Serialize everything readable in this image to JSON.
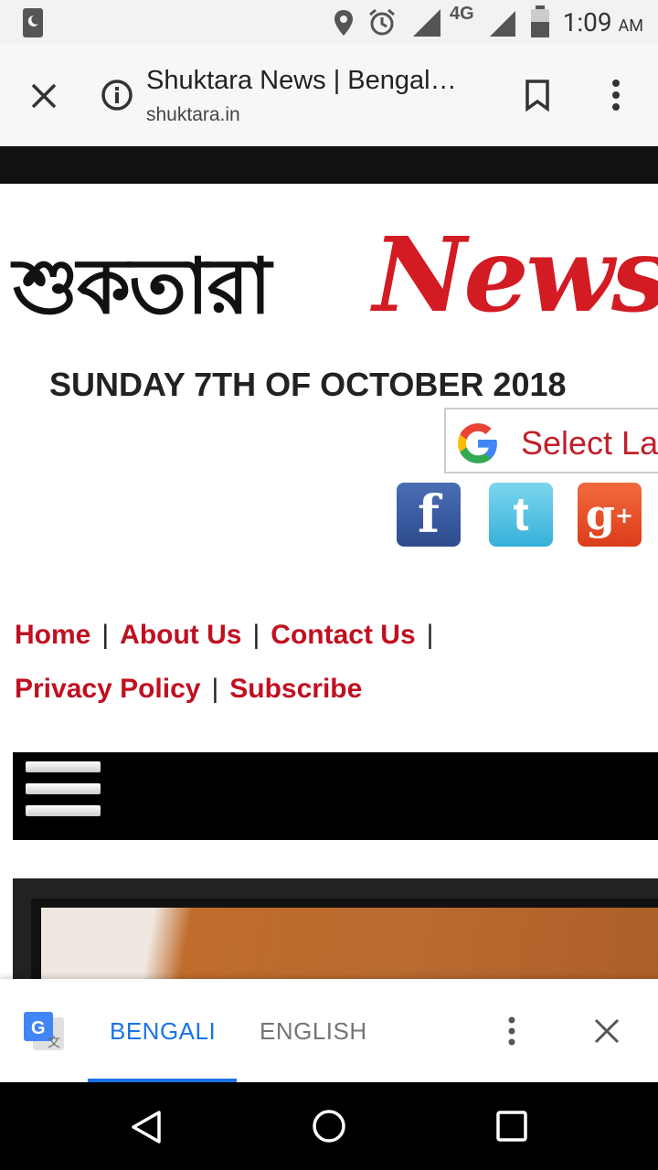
{
  "status_bar": {
    "time": "1:09",
    "ampm": "AM",
    "network": "4G"
  },
  "toolbar": {
    "title": "Shuktara News | Bengal…",
    "url": "shuktara.in"
  },
  "site": {
    "logo_bengali": "শুকতারা",
    "logo_news": "News",
    "date": "SUNDAY 7TH OF OCTOBER 2018",
    "translate_label": "Select La",
    "social": [
      "facebook",
      "twitter",
      "google-plus"
    ],
    "nav": {
      "row1": [
        "Home",
        "About Us",
        "Contact Us"
      ],
      "row2": [
        "Privacy Policy",
        "Subscribe"
      ]
    }
  },
  "translate_bar": {
    "bengali": "BENGALI",
    "english": "ENGLISH"
  },
  "colors": {
    "accent": "#d31b23",
    "link": "#c01020",
    "translate_blue": "#1a73e8"
  }
}
